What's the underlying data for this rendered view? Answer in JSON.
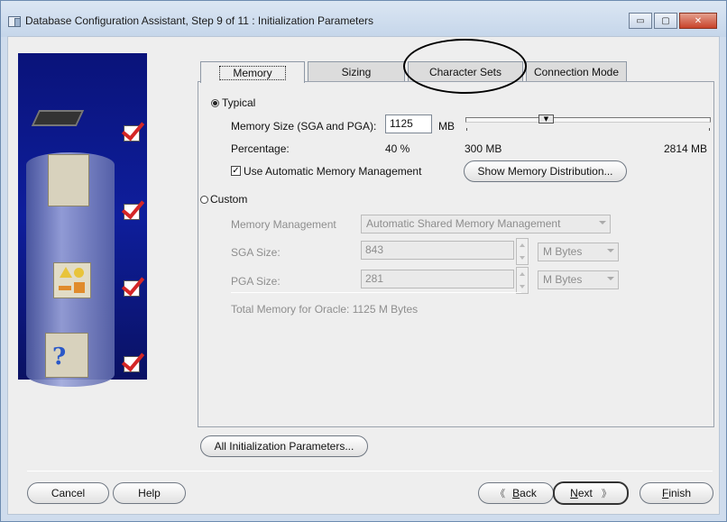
{
  "window": {
    "title": "Database Configuration Assistant, Step 9 of 11 : Initialization Parameters",
    "minimize_glyph": "▭",
    "maximize_glyph": "▢",
    "close_glyph": "✕"
  },
  "tabs": [
    {
      "label": "Memory",
      "active": true
    },
    {
      "label": "Sizing",
      "active": false
    },
    {
      "label": "Character Sets",
      "active": false
    },
    {
      "label": "Connection Mode",
      "active": false
    }
  ],
  "memory": {
    "typical_label": "Typical",
    "typical_selected": true,
    "memory_size_label": "Memory Size (SGA and PGA):",
    "memory_size_value": "1125",
    "memory_size_unit": "MB",
    "percentage_label": "Percentage:",
    "percentage_value": "40 %",
    "slider_min_label": "300 MB",
    "slider_max_label": "2814 MB",
    "slider_thumb_glyph": "▼",
    "use_amm_label": "Use Automatic Memory Management",
    "use_amm_checked": true,
    "use_amm_glyph": "✓",
    "show_distribution_button": "Show Memory Distribution...",
    "custom_label": "Custom",
    "custom_selected": false,
    "memory_management_label": "Memory Management",
    "memory_management_value": "Automatic Shared Memory Management",
    "sga_size_label": "SGA Size:",
    "sga_size_value": "843",
    "sga_unit": "M Bytes",
    "pga_size_label": "PGA Size:",
    "pga_size_value": "281",
    "pga_unit": "M Bytes",
    "total_memory_text": "Total Memory for Oracle:  1125 M Bytes"
  },
  "buttons": {
    "all_init_params": "All Initialization Parameters...",
    "cancel": "Cancel",
    "help": "Help",
    "back_glyph": "《",
    "back_prefix": "",
    "back_mnemonic": "B",
    "back_rest": "ack",
    "next_mnemonic": "N",
    "next_rest": "ext",
    "next_glyph": "》",
    "finish_mnemonic": "F",
    "finish_rest": "inish"
  },
  "sidebar": {
    "steps_completed": [
      true,
      true,
      true,
      true
    ],
    "question_glyph": "?"
  },
  "colors": {
    "sidebar_blue": "#0e1e9c",
    "check_red": "#d42626",
    "window_chrome": "#cfdced"
  },
  "annotation": {
    "shape": "ellipse-around-character-sets-tab"
  }
}
